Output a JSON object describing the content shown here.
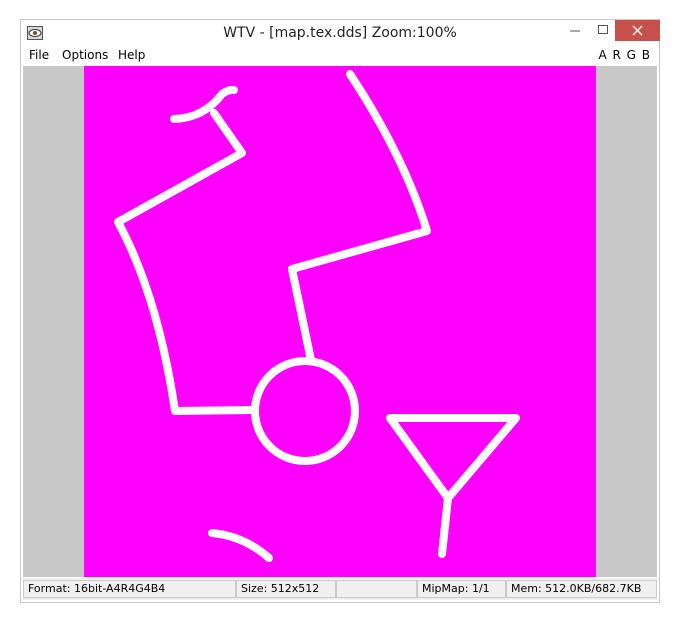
{
  "window": {
    "title": "WTV - [map.tex.dds] Zoom:100%"
  },
  "menu": {
    "file": "File",
    "options": "Options",
    "help": "Help",
    "channels": "A R G B"
  },
  "icons": {
    "app": "eye-icon",
    "minimize": "minimize-icon",
    "maximize": "maximize-icon",
    "close": "close-icon"
  },
  "colors": {
    "texture_background": "#ff00ff",
    "texture_lines": "#ffffff",
    "viewport_background": "#c8c8c8",
    "close_button": "#c7504a"
  },
  "status": {
    "format": "Format: 16bit-A4R4G4B4",
    "size": "Size: 512x512",
    "empty": "",
    "mipmap": "MipMap: 1/1",
    "mem": "Mem: 512.0KB/682.7KB"
  }
}
